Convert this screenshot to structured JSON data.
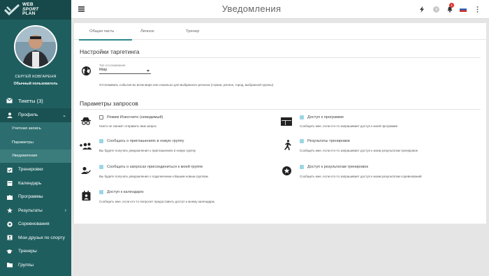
{
  "app": {
    "logo_line1": "WEB",
    "logo_line2": "SPORT",
    "logo_line3": "PLAN"
  },
  "user": {
    "name": "СЕРГЕЙ КОВГАРЕНЯ",
    "role": "Обычный пользователь"
  },
  "sidebar": {
    "items": [
      {
        "label": "Тикеты (3)",
        "icon": "envelope-icon"
      },
      {
        "label": "Профиль",
        "icon": "person-icon"
      },
      {
        "label": "Учетная запись"
      },
      {
        "label": "Параметры"
      },
      {
        "label": "Уведомления"
      },
      {
        "label": "Тренировки",
        "icon": "calendar-check-icon"
      },
      {
        "label": "Календарь",
        "icon": "calendar-icon"
      },
      {
        "label": "Программы",
        "icon": "puzzle-icon"
      },
      {
        "label": "Результаты",
        "icon": "star-icon"
      },
      {
        "label": "Соревнования",
        "icon": "trophy-icon"
      },
      {
        "label": "Мои друзья по спорту",
        "icon": "friends-icon"
      },
      {
        "label": "Тренеры",
        "icon": "mortarboard-icon"
      },
      {
        "label": "Группы",
        "icon": "group-icon"
      }
    ]
  },
  "header": {
    "title": "Уведомления",
    "notification_count": "1"
  },
  "tabs": [
    "Общая часть",
    "Личное",
    "Тренер"
  ],
  "targeting": {
    "title": "Настройки таргетинга",
    "select_label": "Тип отслеживания",
    "select_value": "Мир",
    "hint": "Отслеживать события во всем мире или локально для выбранного региона (страна, регион, город, выбранной группы)"
  },
  "requests": {
    "title": "Параметры запросов",
    "left": [
      {
        "label": "Режим Инкогнито (невидимый)",
        "hint": "Никто не сможет отправить вам запрос",
        "checked": false,
        "icon": "incognito-icon"
      },
      {
        "label": "Сообщать о приглашениях в новую группу",
        "hint": "Вы будете получать уведомления о приглашениях в новую группу",
        "checked": true,
        "icon": "group-add-icon"
      },
      {
        "label": "Сообщать о запросах присоединиться к моей группе",
        "hint": "Вы будете получать уведомления о подключении к Вашим новым группам",
        "checked": true,
        "icon": "person-check-icon"
      },
      {
        "label": "Доступ к календарю",
        "hint": "Сообщить мне, если кто-то попросит предоставить доступ к моему календарю",
        "checked": true,
        "icon": "calendar-person-icon"
      }
    ],
    "right": [
      {
        "label": "Доступ к программе",
        "hint": "Сообщить мне, если кто-то запрашивает доступ к моей программе",
        "checked": true,
        "icon": "web-icon"
      },
      {
        "label": "Результаты тренировки",
        "hint": "Сообщить мне, если кто-то запрашивает доступ к моим результатам тренировок",
        "checked": true,
        "icon": "runner-icon"
      },
      {
        "label": "Доступ к результатам тренировок",
        "hint": "Сообщить мне, если кто-то запрашивает доступ к моим результатам соревнований",
        "checked": true,
        "icon": "star-badge-icon"
      }
    ]
  },
  "colors": {
    "sidebar": "#1f5e5f",
    "accent": "#2b8a8a",
    "checkbox": "#9bd6e4"
  }
}
